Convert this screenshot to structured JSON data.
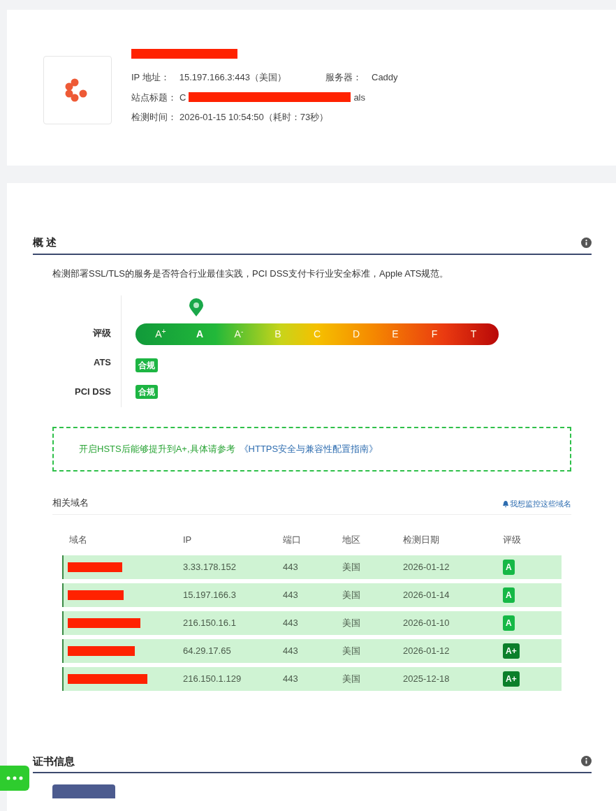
{
  "site": {
    "fields": [
      {
        "label": "IP 地址：",
        "value": "15.197.166.3:443（美国）"
      },
      {
        "label": "服务器：",
        "value": "Caddy"
      }
    ],
    "title_field": {
      "label": "站点标题：",
      "visible_start": "C",
      "visible_end": "als"
    },
    "time_field": {
      "label": "检测时间：",
      "value": "2026-01-15 10:54:50（耗时：73秒）"
    }
  },
  "overview": {
    "title": "概 述",
    "description": "检测部署SSL/TLS的服务是否符合行业最佳实践，PCI DSS支付卡行业安全标准，Apple ATS规范。",
    "rating_label": "评级",
    "grades": [
      {
        "label": "A$^{+}$",
        "selected": false
      },
      {
        "label": "A",
        "selected": true
      },
      {
        "label": "A$^{-}$",
        "selected": false
      },
      {
        "label": "B",
        "selected": false
      },
      {
        "label": "C",
        "selected": false
      },
      {
        "label": "D",
        "selected": false
      },
      {
        "label": "E",
        "selected": false
      },
      {
        "label": "F",
        "selected": false
      },
      {
        "label": "T",
        "selected": false
      }
    ],
    "compliance": [
      {
        "label": "ATS",
        "status": "合规"
      },
      {
        "label": "PCI DSS",
        "status": "合规"
      }
    ],
    "tip": {
      "text": "开启HSTS后能够提升到A+,具体请参考",
      "link": "《HTTPS安全与兼容性配置指南》"
    }
  },
  "related": {
    "title": "相关域名",
    "monitor_link": "我想监控这些域名",
    "columns": [
      "域名",
      "IP",
      "端口",
      "地区",
      "检测日期",
      "评级"
    ],
    "rows": [
      {
        "ip": "3.33.178.152",
        "port": "443",
        "region": "美国",
        "date": "2026-01-12",
        "grade": "A",
        "color": "#16b846"
      },
      {
        "ip": "15.197.166.3",
        "port": "443",
        "region": "美国",
        "date": "2026-01-14",
        "grade": "A",
        "color": "#16b846"
      },
      {
        "ip": "216.150.16.1",
        "port": "443",
        "region": "美国",
        "date": "2026-01-10",
        "grade": "A",
        "color": "#16b846"
      },
      {
        "ip": "64.29.17.65",
        "port": "443",
        "region": "美国",
        "date": "2026-01-12",
        "grade": "A+",
        "color": "#0b7f2a"
      },
      {
        "ip": "216.150.1.129",
        "port": "443",
        "region": "美国",
        "date": "2025-12-18",
        "grade": "A+",
        "color": "#0b7f2a"
      }
    ]
  },
  "cert": {
    "title": "证书信息"
  }
}
